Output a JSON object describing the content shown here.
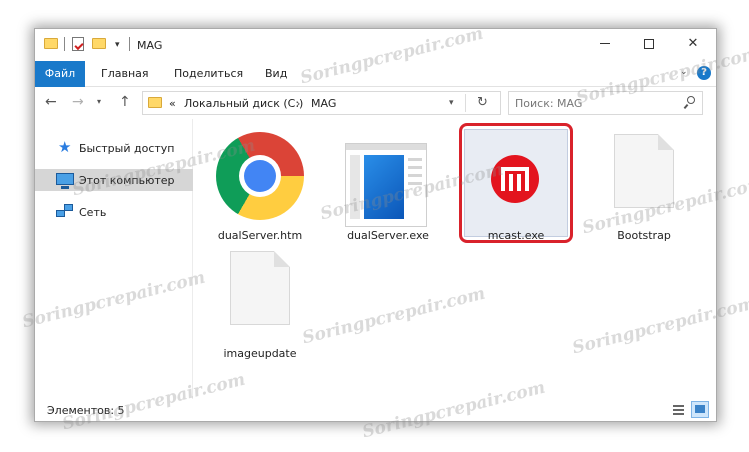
{
  "window": {
    "title": "MAG"
  },
  "ribbon": {
    "file": "Файл",
    "tabs": [
      "Главная",
      "Поделиться",
      "Вид"
    ]
  },
  "address": {
    "prefix": "«",
    "path": [
      "Локальный диск (C:)",
      "MAG"
    ]
  },
  "search": {
    "placeholder": "Поиск: MAG"
  },
  "sidebar": {
    "items": [
      {
        "label": "Быстрый доступ",
        "icon": "star-icon"
      },
      {
        "label": "Этот компьютер",
        "icon": "pc-icon",
        "selected": true
      },
      {
        "label": "Сеть",
        "icon": "network-icon"
      }
    ]
  },
  "files": [
    {
      "name": "dualServer.htm",
      "icon": "chrome-icon"
    },
    {
      "name": "dualServer.exe",
      "icon": "exe-window-icon"
    },
    {
      "name": "mcast.exe",
      "icon": "mcast-icon",
      "highlighted": true
    },
    {
      "name": "Bootstrap",
      "icon": "blank-document-icon"
    },
    {
      "name": "imageupdate",
      "icon": "blank-document-icon"
    }
  ],
  "status": {
    "count": "Элементов: 5"
  },
  "watermark": "Soringpcrepair.com",
  "colors": {
    "accent": "#1979ca",
    "highlight": "#d9222b",
    "selection": "#d6d6d6"
  }
}
